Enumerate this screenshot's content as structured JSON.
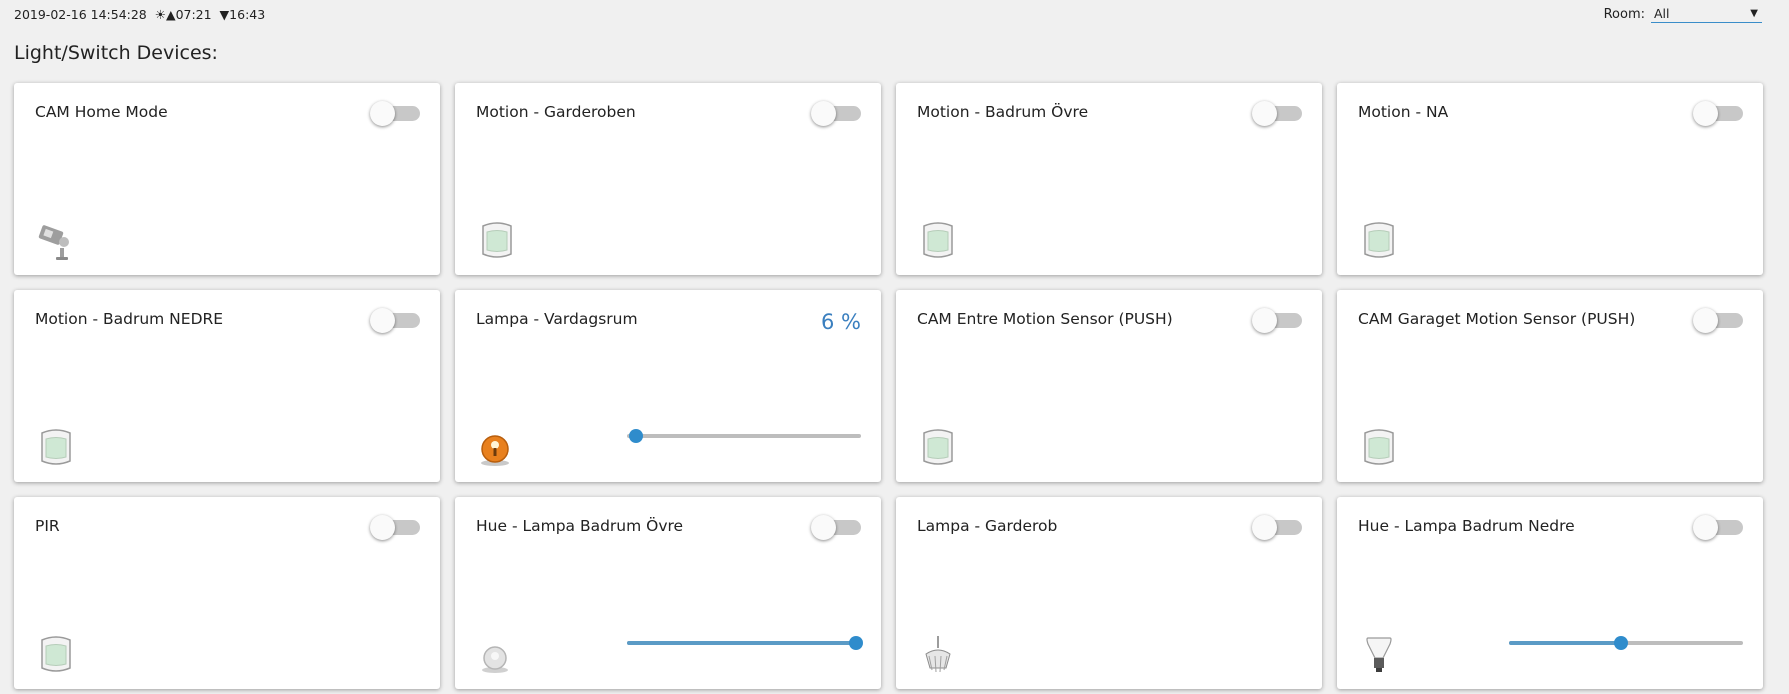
{
  "header": {
    "datetime": "2019-02-16 14:54:28",
    "sun_icon": "sun-icon",
    "sunrise": "07:21",
    "sunset": "16:43",
    "room_label": "Room:",
    "room_selected": "All"
  },
  "section_title": "Light/Switch Devices:",
  "devices": [
    {
      "title": "CAM Home Mode",
      "control": "toggle",
      "on": false,
      "icon": "camera-icon"
    },
    {
      "title": "Motion - Garderoben",
      "control": "toggle",
      "on": false,
      "icon": "motion-sensor-icon"
    },
    {
      "title": "Motion - Badrum Övre",
      "control": "toggle",
      "on": false,
      "icon": "motion-sensor-icon"
    },
    {
      "title": "Motion - NA",
      "control": "toggle",
      "on": false,
      "icon": "motion-sensor-icon"
    },
    {
      "title": "Motion - Badrum NEDRE",
      "control": "toggle",
      "on": false,
      "icon": "motion-sensor-icon"
    },
    {
      "title": "Lampa - Vardagsrum",
      "control": "dimmer",
      "percent_label": "6 %",
      "level": 0.04,
      "icon": "lamp-orange-icon"
    },
    {
      "title": "CAM Entre Motion Sensor (PUSH)",
      "control": "toggle",
      "on": false,
      "icon": "motion-sensor-icon"
    },
    {
      "title": "CAM Garaget Motion Sensor (PUSH)",
      "control": "toggle",
      "on": false,
      "icon": "motion-sensor-icon"
    },
    {
      "title": "PIR",
      "control": "toggle",
      "on": false,
      "icon": "motion-sensor-icon"
    },
    {
      "title": "Hue - Lampa Badrum Övre",
      "control": "toggle-slider",
      "on": false,
      "level": 0.98,
      "icon": "bulb-gray-icon"
    },
    {
      "title": "Lampa - Garderob",
      "control": "toggle",
      "on": false,
      "icon": "chandelier-icon"
    },
    {
      "title": "Hue - Lampa Badrum Nedre",
      "control": "toggle-slider",
      "on": false,
      "level": 0.48,
      "icon": "hue-bulb-icon"
    }
  ],
  "colors": {
    "accent": "#2f8ccc",
    "slider_fill": "#5b9bc6",
    "percent_text": "#3a7fbf",
    "toggle_track": "#c8c8c8"
  }
}
